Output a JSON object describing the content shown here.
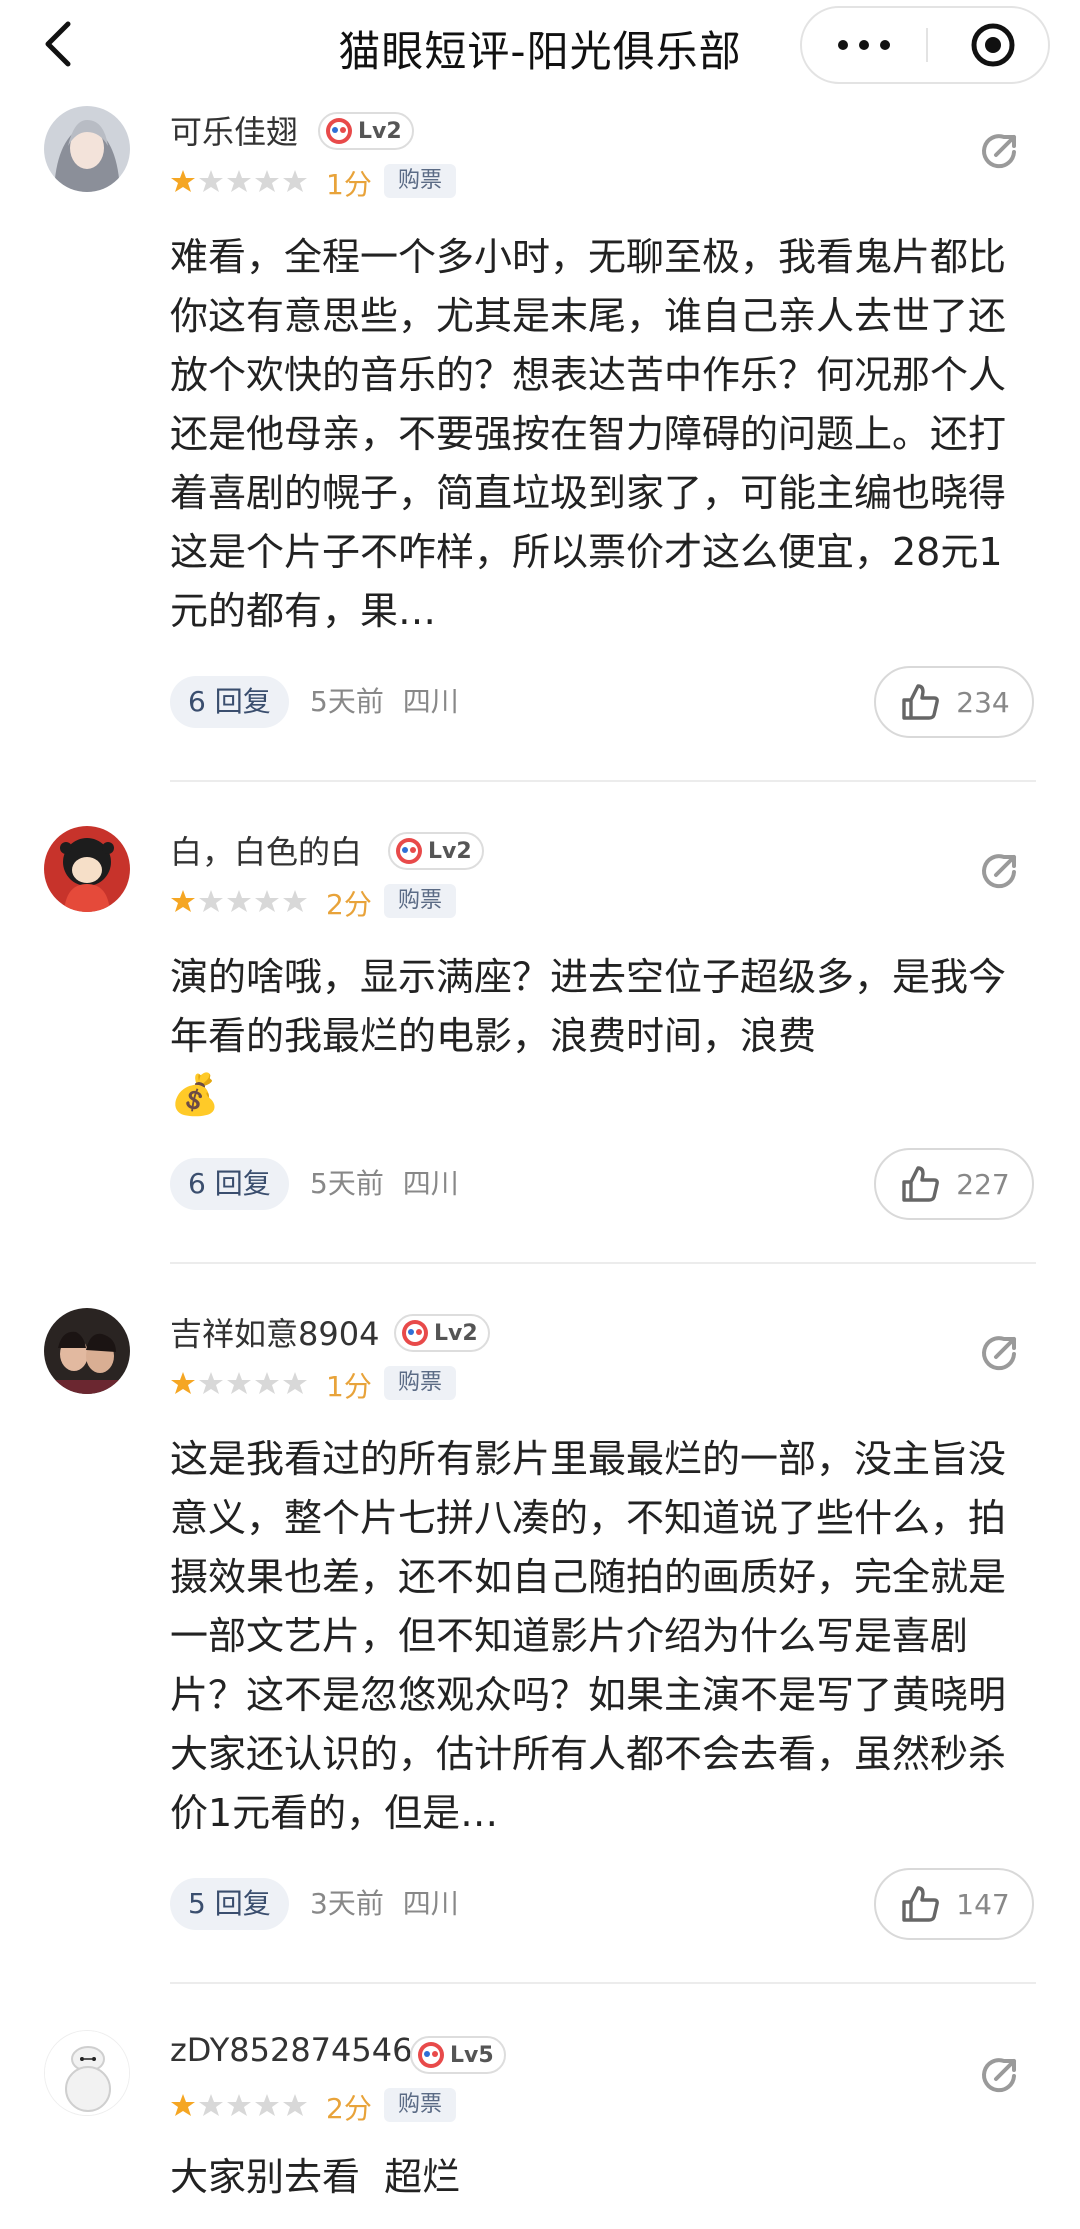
{
  "header": {
    "title": "猫眼短评-阳光俱乐部"
  },
  "icons": {
    "back": "chevron-left-icon",
    "more": "more-dots-icon",
    "close": "target-circle-icon",
    "share": "share-icon",
    "like": "thumb-up-icon",
    "star": "star-icon",
    "level": "user-level-icon"
  },
  "colors": {
    "star_filled": "#f5a623",
    "star_empty": "#d8d8d8",
    "score": "#e8a33a",
    "pill_bg": "#eef1f6"
  },
  "comments": [
    {
      "username": "可乐佳翅",
      "level": "Lv2",
      "rating_stars": 1,
      "score": "1分",
      "tag": "购票",
      "text": "难看，全程一个多小时，无聊至极，我看鬼片都比你这有意思些，尤其是末尾，谁自己亲人去世了还放个欢快的音乐的？想表达苦中作乐？何况那个人还是他母亲，不要强按在智力障碍的问题上。还打着喜剧的幌子，简直垃圾到家了，可能主编也晓得这是个片子不咋样，所以票价才这么便宜，28元1元的都有，果…",
      "replies": "6 回复",
      "time": "5天前",
      "location": "四川",
      "likes": "234"
    },
    {
      "username": "白，白色的白",
      "level": "Lv2",
      "rating_stars": 1,
      "score": "2分",
      "tag": "购票",
      "text": "演的啥哦，显示满座？进去空位子超级多，是我今年看的我最烂的电影，浪费时间，浪费",
      "emoji": "💰",
      "replies": "6 回复",
      "time": "5天前",
      "location": "四川",
      "likes": "227"
    },
    {
      "username": "吉祥如意8904",
      "level": "Lv2",
      "rating_stars": 1,
      "score": "1分",
      "tag": "购票",
      "text": "这是我看过的所有影片里最最烂的一部，没主旨没意义，整个片七拼八凑的，不知道说了些什么，拍摄效果也差，还不如自己随拍的画质好，完全就是一部文艺片，但不知道影片介绍为什么写是喜剧片？这不是忽悠观众吗？如果主演不是写了黄晓明大家还认识的，估计所有人都不会去看，虽然秒杀价1元看的，但是…",
      "replies": "5 回复",
      "time": "3天前",
      "location": "四川",
      "likes": "147"
    },
    {
      "username": "zDY852874546",
      "level": "Lv5",
      "rating_stars": 1,
      "score": "2分",
      "tag": "购票",
      "text": "大家别去看  超烂"
    }
  ]
}
